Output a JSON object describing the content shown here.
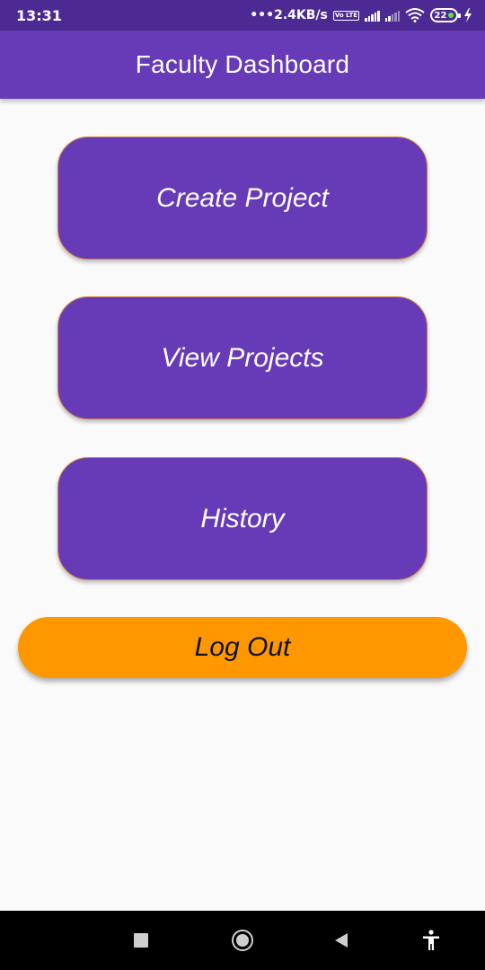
{
  "status_bar": {
    "time": "13:31",
    "network_speed": "•••2.4KB/s",
    "volte_label": "Vo LTE",
    "battery_level": "22",
    "icons": [
      "volte-icon",
      "signal-icon",
      "signal-weak-icon",
      "wifi-icon",
      "battery-icon",
      "charging-icon"
    ]
  },
  "app_bar": {
    "title": "Faculty Dashboard"
  },
  "buttons": {
    "create_project": "Create Project",
    "view_projects": "View Projects",
    "history": "History",
    "log_out": "Log Out"
  },
  "nav_bar": {
    "icons": [
      "recent-apps-icon",
      "home-icon",
      "back-icon",
      "accessibility-icon"
    ]
  },
  "colors": {
    "status_bar": "#4d2a93",
    "primary": "#673ab7",
    "button_border": "#d9823a",
    "logout": "#ff9800",
    "background": "#fafafa"
  }
}
